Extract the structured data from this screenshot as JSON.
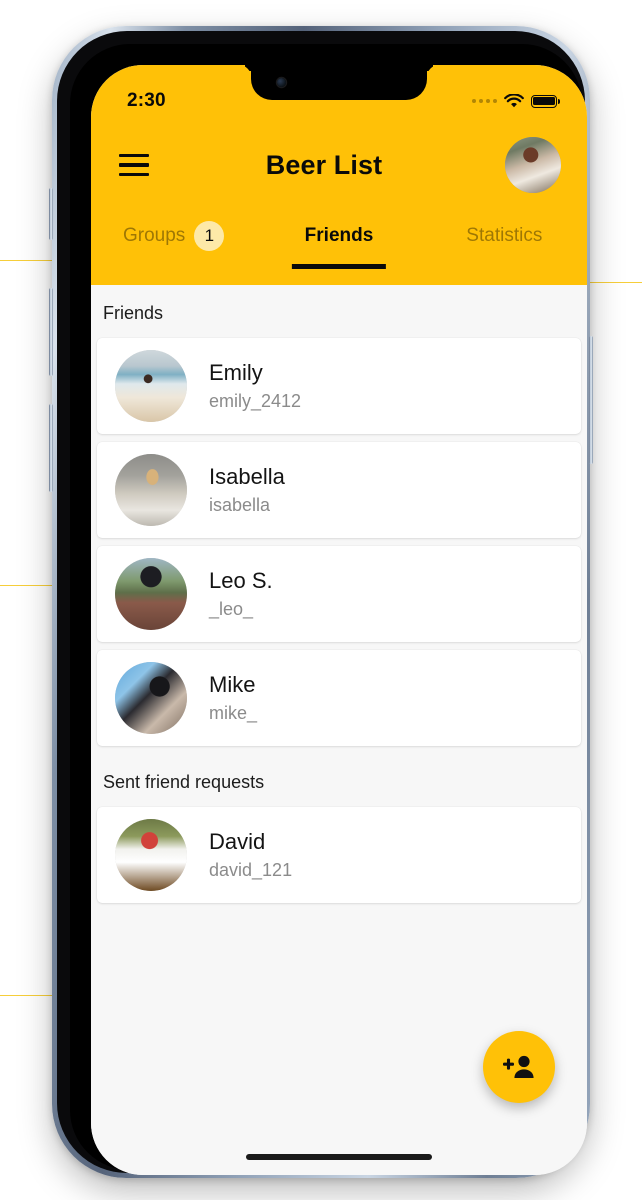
{
  "status_bar": {
    "time": "2:30",
    "signal_icon": "signal-dots-icon",
    "wifi_icon": "wifi-icon",
    "battery_icon": "battery-full-icon"
  },
  "header": {
    "menu_icon": "hamburger-menu-icon",
    "title": "Beer List",
    "avatar_icon": "user-avatar"
  },
  "tabs": [
    {
      "label": "Groups",
      "badge": "1",
      "active": false
    },
    {
      "label": "Friends",
      "badge": null,
      "active": true
    },
    {
      "label": "Statistics",
      "badge": null,
      "active": false
    }
  ],
  "sections": [
    {
      "title": "Friends",
      "items": [
        {
          "name": "Emily",
          "handle": "emily_2412"
        },
        {
          "name": "Isabella",
          "handle": "isabella"
        },
        {
          "name": "Leo S.",
          "handle": "_leo_"
        },
        {
          "name": "Mike",
          "handle": "mike_"
        }
      ]
    },
    {
      "title": "Sent friend requests",
      "items": [
        {
          "name": "David",
          "handle": "david_121"
        }
      ]
    }
  ],
  "fab": {
    "icon": "person-add-icon",
    "label": "Add friend"
  },
  "colors": {
    "accent": "#FFC107",
    "badge_bg": "#FDE9A8",
    "screen_bg": "#F7F7F7",
    "card_bg": "#FFFFFF",
    "text_primary": "#141414",
    "text_secondary": "#8B8B8B",
    "tab_inactive": "#616161"
  }
}
